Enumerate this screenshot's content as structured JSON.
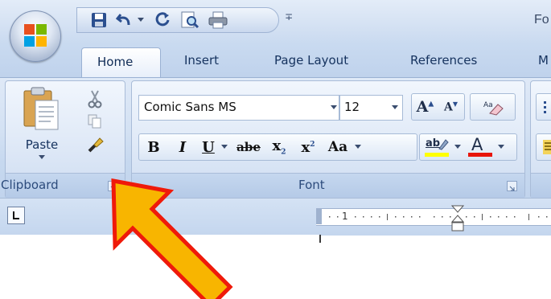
{
  "window": {
    "title_partial": "Fo"
  },
  "qat": {
    "customize_glyph": "∓"
  },
  "tabs": [
    {
      "label": "Home",
      "active": true
    },
    {
      "label": "Insert"
    },
    {
      "label": "Page Layout"
    },
    {
      "label": "References"
    },
    {
      "label": "M"
    }
  ],
  "clipboard": {
    "group_label": "Clipboard",
    "paste_label": "Paste",
    "cut_icon": "scissors-icon",
    "copy_icon": "copy-icon",
    "format_painter_icon": "format-painter-icon"
  },
  "font": {
    "group_label": "Font",
    "font_name": "Comic Sans MS",
    "font_size": "12",
    "grow_label": "A",
    "shrink_label": "A",
    "bold": "B",
    "italic": "I",
    "underline": "U",
    "strikethrough": "abe",
    "subscript": "x",
    "superscript": "x",
    "change_case": "Aa",
    "highlight": "ab",
    "font_color": "A"
  },
  "ruler": {
    "mark": "1"
  },
  "colors": {
    "highlight_yellow": "#ffff00",
    "font_color_red": "#e8160c",
    "arrow_fill": "#f8b500",
    "arrow_stroke": "#ef1a0a"
  }
}
